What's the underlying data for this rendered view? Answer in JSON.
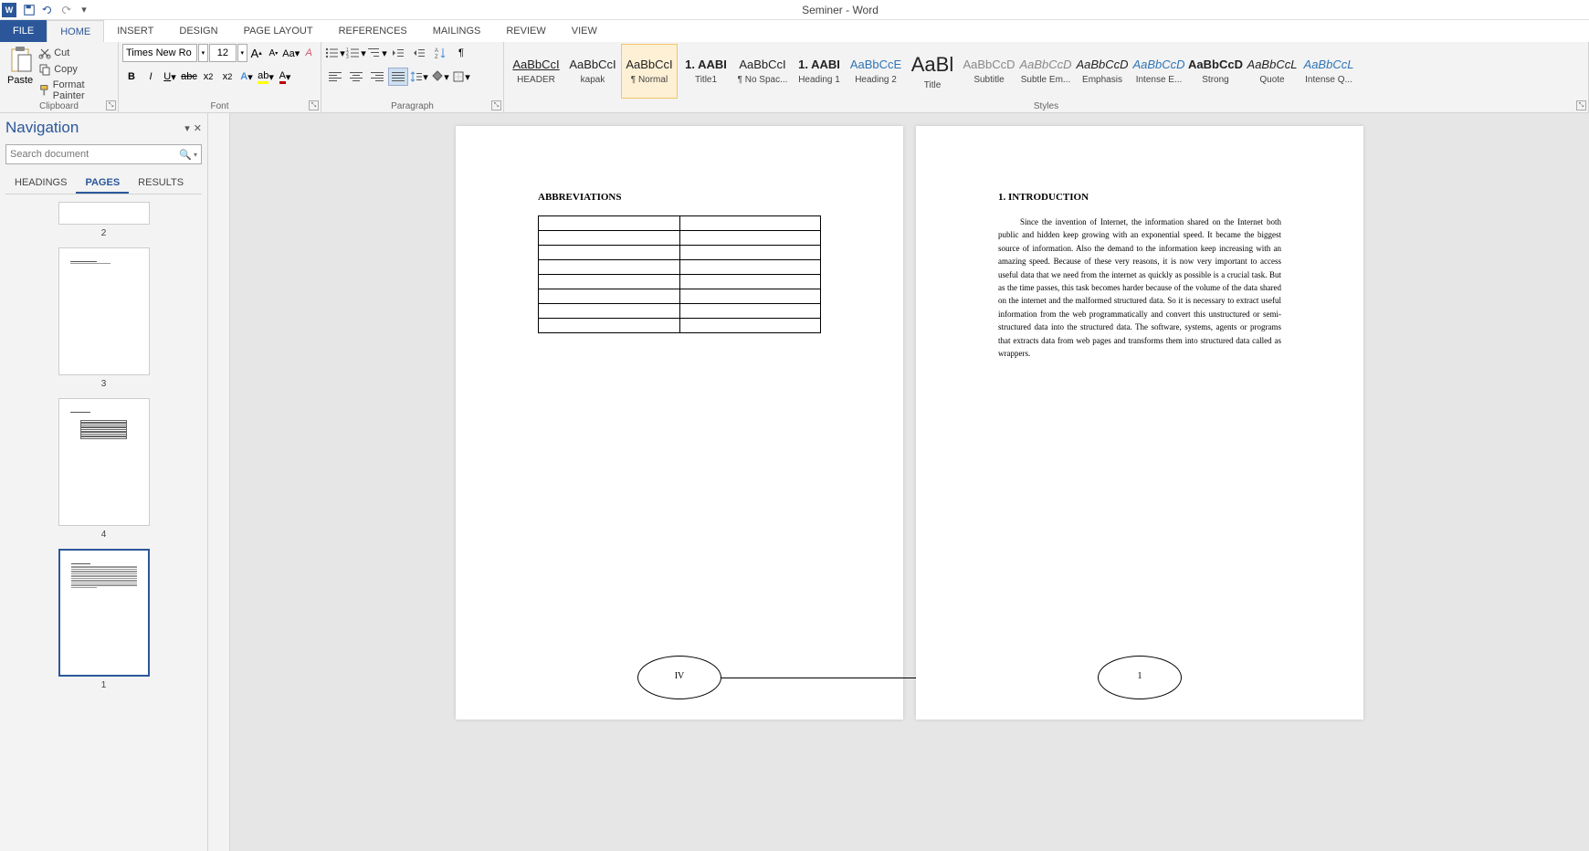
{
  "titlebar": {
    "app_icon_letter": "W",
    "title": "Seminer - Word"
  },
  "tabs": {
    "file": "FILE",
    "home": "HOME",
    "insert": "INSERT",
    "design": "DESIGN",
    "page_layout": "PAGE LAYOUT",
    "references": "REFERENCES",
    "mailings": "MAILINGS",
    "review": "REVIEW",
    "view": "VIEW"
  },
  "clipboard": {
    "paste": "Paste",
    "cut": "Cut",
    "copy": "Copy",
    "format_painter": "Format Painter",
    "group_label": "Clipboard"
  },
  "font": {
    "name": "Times New Ro",
    "size": "12",
    "group_label": "Font"
  },
  "paragraph": {
    "group_label": "Paragraph"
  },
  "styles": {
    "group_label": "Styles",
    "items": [
      {
        "preview": "AaBbCcI",
        "name": "HEADER",
        "underline": true
      },
      {
        "preview": "AaBbCcI",
        "name": "kapak"
      },
      {
        "preview": "AaBbCcI",
        "name": "¶ Normal",
        "selected": true
      },
      {
        "preview": "1. AABI",
        "name": "Title1",
        "bold": true
      },
      {
        "preview": "AaBbCcI",
        "name": "¶ No Spac..."
      },
      {
        "preview": "1. AABI",
        "name": "Heading 1",
        "bold": true
      },
      {
        "preview": "AaBbCcE",
        "name": "Heading 2",
        "color": "#2e74b5"
      },
      {
        "preview": "AaBl",
        "name": "Title",
        "big": true
      },
      {
        "preview": "AaBbCcD",
        "name": "Subtitle",
        "color": "#888"
      },
      {
        "preview": "AaBbCcD",
        "name": "Subtle Em...",
        "color": "#888",
        "italic": true
      },
      {
        "preview": "AaBbCcD",
        "name": "Emphasis",
        "italic": true
      },
      {
        "preview": "AaBbCcD",
        "name": "Intense E...",
        "color": "#2e74b5",
        "italic": true
      },
      {
        "preview": "AaBbCcD",
        "name": "Strong",
        "bold": true
      },
      {
        "preview": "AaBbCcL",
        "name": "Quote",
        "italic": true
      },
      {
        "preview": "AaBbCcL",
        "name": "Intense Q...",
        "color": "#2e74b5",
        "italic": true
      }
    ]
  },
  "navigation": {
    "title": "Navigation",
    "search_placeholder": "Search document",
    "tabs": {
      "headings": "HEADINGS",
      "pages": "PAGES",
      "results": "RESULTS"
    },
    "thumbs": [
      {
        "num": "2"
      },
      {
        "num": "3"
      },
      {
        "num": "4"
      },
      {
        "num": "1",
        "selected": true
      }
    ]
  },
  "document": {
    "page_left": {
      "heading": "ABBREVIATIONS",
      "footer_num": "IV"
    },
    "page_right": {
      "heading": "1. INTRODUCTION",
      "body": "Since the invention of Internet, the information shared on the Internet both public and hidden keep growing with an exponential speed. It became the biggest source of information. Also the demand to the information keep increasing with an amazing speed. Because of these very reasons, it is now very important to access useful data that we need from the internet as quickly as possible is a crucial task. But as the time passes, this task becomes harder because of the volume of the data shared on the internet and the malformed structured data. So it is necessary to extract useful information from the web programmatically and convert this unstructured or semi-structured data into the structured data. The software, systems, agents or programs that extracts data from web pages and transforms them into structured data called as wrappers.",
      "footer_num": "1"
    }
  }
}
